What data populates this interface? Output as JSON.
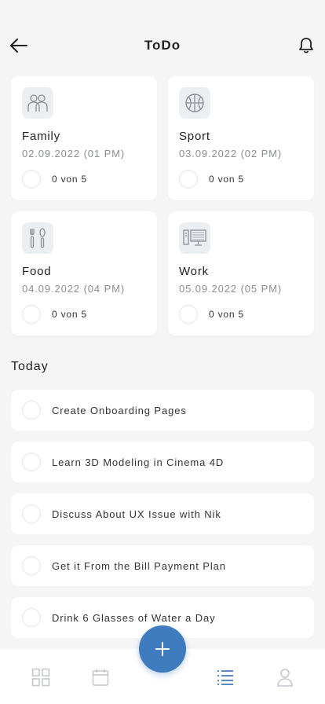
{
  "header": {
    "title": "ToDo",
    "back_icon": "arrow-left-icon",
    "notification_icon": "bell-icon"
  },
  "categories": [
    {
      "title": "Family",
      "date": "02.09.2022 (01 PM)",
      "progress": "0 von 5",
      "icon": "family-icon"
    },
    {
      "title": "Sport",
      "date": "03.09.2022 (02 PM)",
      "progress": "0 von 5",
      "icon": "basketball-icon"
    },
    {
      "title": "Food",
      "date": "04.09.2022 (04 PM)",
      "progress": "0 von 5",
      "icon": "cutlery-icon"
    },
    {
      "title": "Work",
      "date": "05.09.2022 (05 PM)",
      "progress": "0 von 5",
      "icon": "computer-icon"
    }
  ],
  "today": {
    "title": "Today",
    "tasks": [
      {
        "label": "Create Onboarding Pages"
      },
      {
        "label": "Learn 3D Modeling in Cinema 4D"
      },
      {
        "label": "Discuss About UX Issue with Nik"
      },
      {
        "label": "Get it From the Bill Payment Plan"
      },
      {
        "label": "Drink 6 Glasses of Water a Day"
      }
    ]
  },
  "bottom_nav": {
    "items": [
      "dashboard-icon",
      "calendar-icon",
      "list-icon",
      "profile-icon"
    ],
    "active": "list-icon",
    "fab_icon": "plus-icon"
  },
  "colors": {
    "accent": "#3f7bbf",
    "background": "#f5f5f6",
    "card": "#ffffff",
    "muted_text": "#8a8d93",
    "inactive_icon": "#c3c6cb"
  }
}
